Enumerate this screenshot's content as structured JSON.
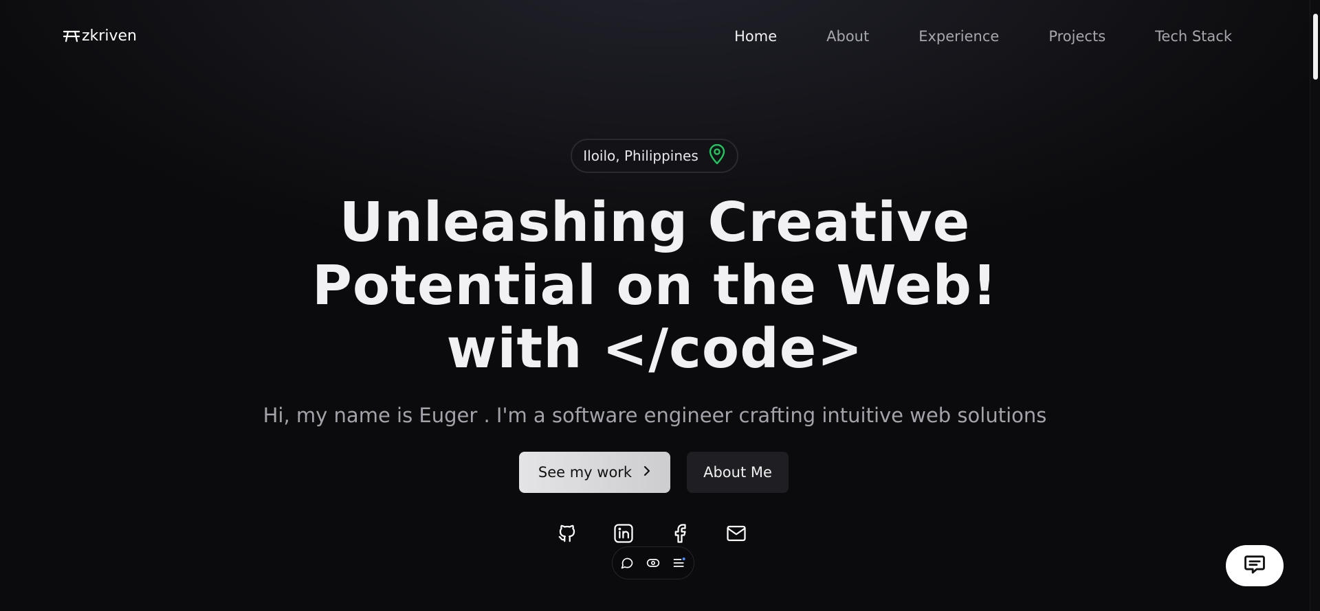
{
  "logo": {
    "text": "zkriven",
    "icon": "picnic-table-icon"
  },
  "nav": {
    "items": [
      {
        "label": "Home",
        "active": true
      },
      {
        "label": "About",
        "active": false
      },
      {
        "label": "Experience",
        "active": false
      },
      {
        "label": "Projects",
        "active": false
      },
      {
        "label": "Tech Stack",
        "active": false
      }
    ]
  },
  "hero": {
    "location": "Iloilo, Philippines",
    "location_icon": "map-pin-icon",
    "location_icon_color": "#22c55e",
    "title_lines": [
      "Unleashing Creative",
      "Potential on the Web!",
      "with </code>"
    ],
    "subtitle": "Hi, my name is Euger . I'm a software engineer crafting intuitive web solutions",
    "primary_button": "See my work",
    "secondary_button": "About Me"
  },
  "socials": [
    "github-icon",
    "linkedin-icon",
    "facebook-icon",
    "mail-icon"
  ],
  "toolbar": [
    "comment-icon",
    "eye-icon",
    "menu-list-icon"
  ],
  "chat_button": {
    "icon": "chat-bubble-icon"
  },
  "colors": {
    "background": "#0b0b0d",
    "accent_green": "#22c55e",
    "text_primary": "#f1f1f3",
    "text_muted": "#a3a3aa"
  }
}
